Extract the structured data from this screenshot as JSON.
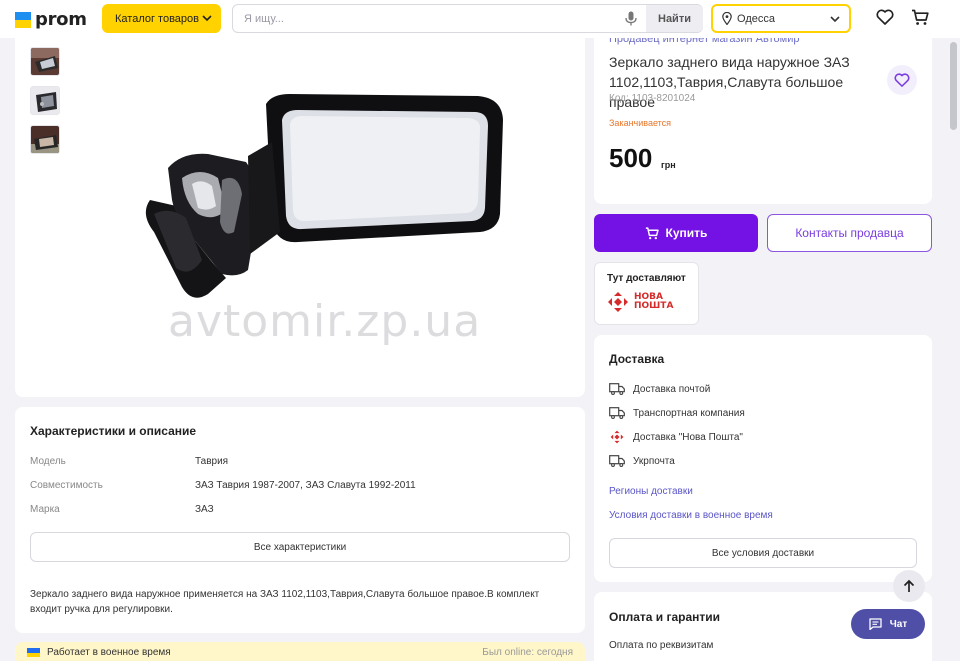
{
  "header": {
    "logo_text": "prom",
    "catalog_label": "Каталог товаров",
    "search_placeholder": "Я ищу...",
    "search_button": "Найти",
    "city": "Одесса"
  },
  "gallery": {
    "watermark": "avtomir.zp.ua",
    "thumbnails": [
      "mirror-photo-1",
      "mirror-photo-2",
      "mirror-photo-3"
    ]
  },
  "product": {
    "seller": "Продавец интернет магазин Автомир",
    "title": "Зеркало заднего вида наружное ЗАЗ 1102,1103,Таврия,Славута большое правое",
    "code": "Код: 1103-8201024",
    "stock_status": "Заканчивается",
    "price": "500",
    "currency": "грн",
    "buy_label": "Купить",
    "contact_label": "Контакты продавца"
  },
  "nova_poshta": {
    "title": "Тут доставляют",
    "logo_line1": "НОВА",
    "logo_line2": "ПОШТА"
  },
  "delivery": {
    "title": "Доставка",
    "items": [
      {
        "label": "Доставка почтой",
        "icon": "truck-icon"
      },
      {
        "label": "Транспортная компания",
        "icon": "truck-icon"
      },
      {
        "label": "Доставка \"Нова Пошта\"",
        "icon": "nova-poshta-icon"
      },
      {
        "label": "Укрпочта",
        "icon": "truck-icon"
      }
    ],
    "links": [
      "Регионы доставки",
      "Условия доставки в военное время"
    ],
    "all_button": "Все условия доставки"
  },
  "payment": {
    "title": "Оплата и гарантии",
    "first_item": "Оплата по реквизитам"
  },
  "specs": {
    "title": "Характеристики и описание",
    "rows": [
      {
        "label": "Модель",
        "value": "Таврия"
      },
      {
        "label": "Совместимость",
        "value": "ЗАЗ Таврия 1987-2007, ЗАЗ Славута 1992-2011"
      },
      {
        "label": "Марка",
        "value": "ЗАЗ"
      }
    ],
    "all_button": "Все характеристики",
    "description": "Зеркало заднего вида наружное применяется на ЗАЗ 1102,1103,Таврия,Славута большое правое.В комплект входит ручка для регулировки."
  },
  "footer_bar": {
    "war_text": "Работает в военное время",
    "online_text": "Был online: сегодня"
  },
  "chat": {
    "label": "Чат"
  },
  "colors": {
    "accent": "#7412e6",
    "catalog": "#ffd200",
    "link": "#5a55c8",
    "stock": "#e8762b",
    "np_red": "#d52b2b"
  }
}
